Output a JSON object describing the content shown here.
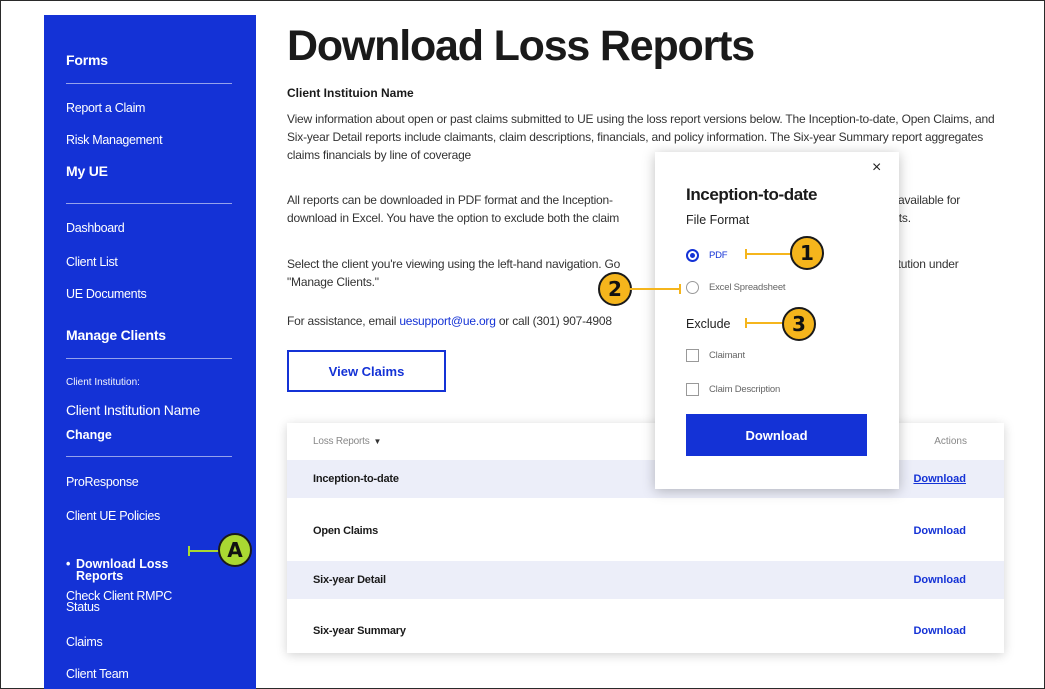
{
  "page": {
    "title": "Download Loss Reports",
    "client_heading": "Client Instituion Name",
    "para1": "View information about open or past claims submitted to UE using the loss report versions below. The Inception-to-date, Open Claims, and Six-year Detail reports include claimants, claim descriptions, financials, and policy information. The Six-year Summary report aggregates claims financials by line of coverage",
    "para2_a": "All reports can be downloaded in PDF format and the Inception-",
    "para2_b": "available for",
    "para2_c": "download in Excel. You have the option to exclude both the claim",
    "para2_d": "rts.",
    "para3_a": "Select the client you're viewing using the left-hand navigation. Go",
    "para3_b": "titution under",
    "para3_c": "\"Manage Clients.\"",
    "para4_prefix": "For assistance, email ",
    "para4_email": "uesupport@ue.org",
    "para4_suffix": " or call (301) 907-4908",
    "view_claims_label": "View Claims"
  },
  "sidebar": {
    "forms_heading": "Forms",
    "report_claim": "Report a Claim",
    "risk_management": "Risk Management",
    "myue_heading": "My UE",
    "dashboard": "Dashboard",
    "client_list": "Client List",
    "ue_documents": "UE Documents",
    "manage_heading": "Manage Clients",
    "client_institution_label": "Client Institution:",
    "client_institution_name": "Client Institution Name",
    "change": "Change",
    "proresponse": "ProResponse",
    "client_ue_policies": "Client UE Policies",
    "active_bullet": "•",
    "active_line1": "Download Loss",
    "active_line2": "Reports",
    "rmpc_line1": "Check Client RMPC",
    "rmpc_line2": "Status",
    "claims": "Claims",
    "client_team": "Client Team"
  },
  "table": {
    "header_left": "Loss Reports",
    "header_caret": "▼",
    "header_right": "Actions",
    "rows": [
      {
        "name": "Inception-to-date",
        "action": "Download"
      },
      {
        "name": "Open Claims",
        "action": "Download"
      },
      {
        "name": "Six-year Detail",
        "action": "Download"
      },
      {
        "name": "Six-year Summary",
        "action": "Download"
      }
    ]
  },
  "popup": {
    "close": "×",
    "title": "Inception-to-date",
    "file_format_label": "File Format",
    "option_pdf": "PDF",
    "option_excel": "Excel Spreadsheet",
    "selected_format": "PDF",
    "exclude_label": "Exclude",
    "check_claimant": "Claimant",
    "check_claim_description": "Claim Description",
    "download_label": "Download"
  },
  "callouts": {
    "one": "1",
    "two": "2",
    "three": "3",
    "a": "A"
  },
  "colors": {
    "brand_blue": "#1432d6",
    "callout_yellow": "#f5b51c",
    "callout_green": "#a9d832",
    "row_shade": "#eceef9"
  }
}
